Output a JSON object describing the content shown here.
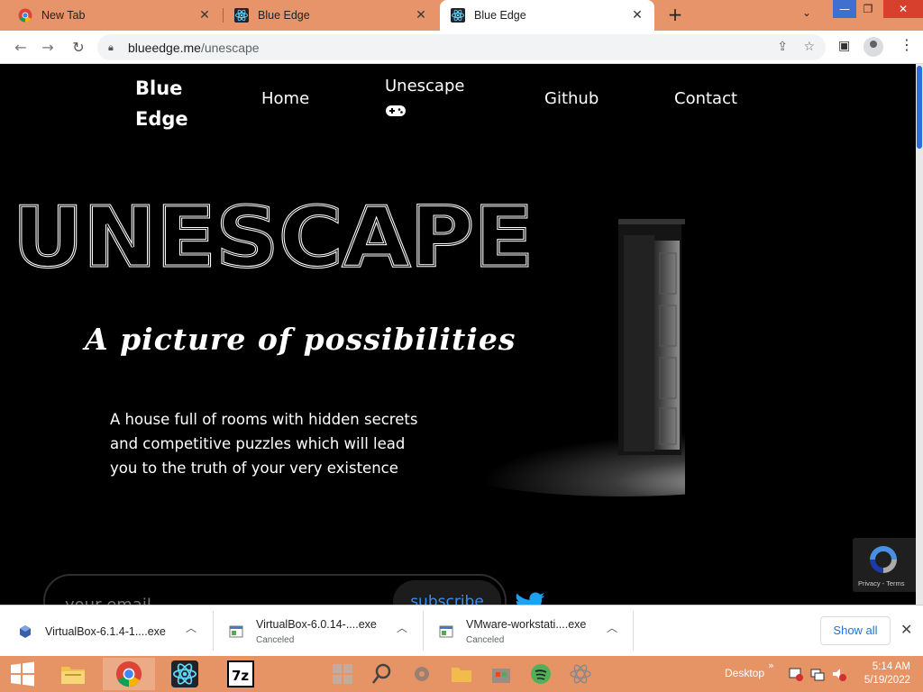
{
  "browser": {
    "tabs": [
      {
        "title": "New Tab",
        "icon": "chrome-icon"
      },
      {
        "title": "Blue Edge",
        "icon": "react-icon"
      },
      {
        "title": "Blue Edge",
        "icon": "react-icon",
        "active": true
      }
    ],
    "url_host": "blueedge.me",
    "url_path": "/unescape"
  },
  "site": {
    "brand_line1": "Blue",
    "brand_line2": "Edge",
    "nav": {
      "home": "Home",
      "unescape": "Unescape",
      "github": "Github",
      "contact": "Contact"
    },
    "hero_title": "UNESCAPE",
    "hero_subtitle": "A picture of possibilities",
    "hero_description": "A house full of rooms with hidden secrets and competitive puzzles which will lead you to the truth of your very existence",
    "email_placeholder": "your email",
    "subscribe_label": "subscribe",
    "recaptcha_text": "Privacy - Terms"
  },
  "downloads": {
    "items": [
      {
        "name": "VirtualBox-6.1.4-1....exe",
        "status": ""
      },
      {
        "name": "VirtualBox-6.0.14-....exe",
        "status": "Canceled"
      },
      {
        "name": "VMware-workstati....exe",
        "status": "Canceled"
      }
    ],
    "show_all": "Show all"
  },
  "taskbar": {
    "desktop_label": "Desktop",
    "time": "5:14 AM",
    "date": "5/19/2022"
  },
  "colors": {
    "tab_strip": "#e8946a",
    "taskbar": "#e69466",
    "accent_blue": "#1a73e8",
    "page_bg": "#000000"
  }
}
